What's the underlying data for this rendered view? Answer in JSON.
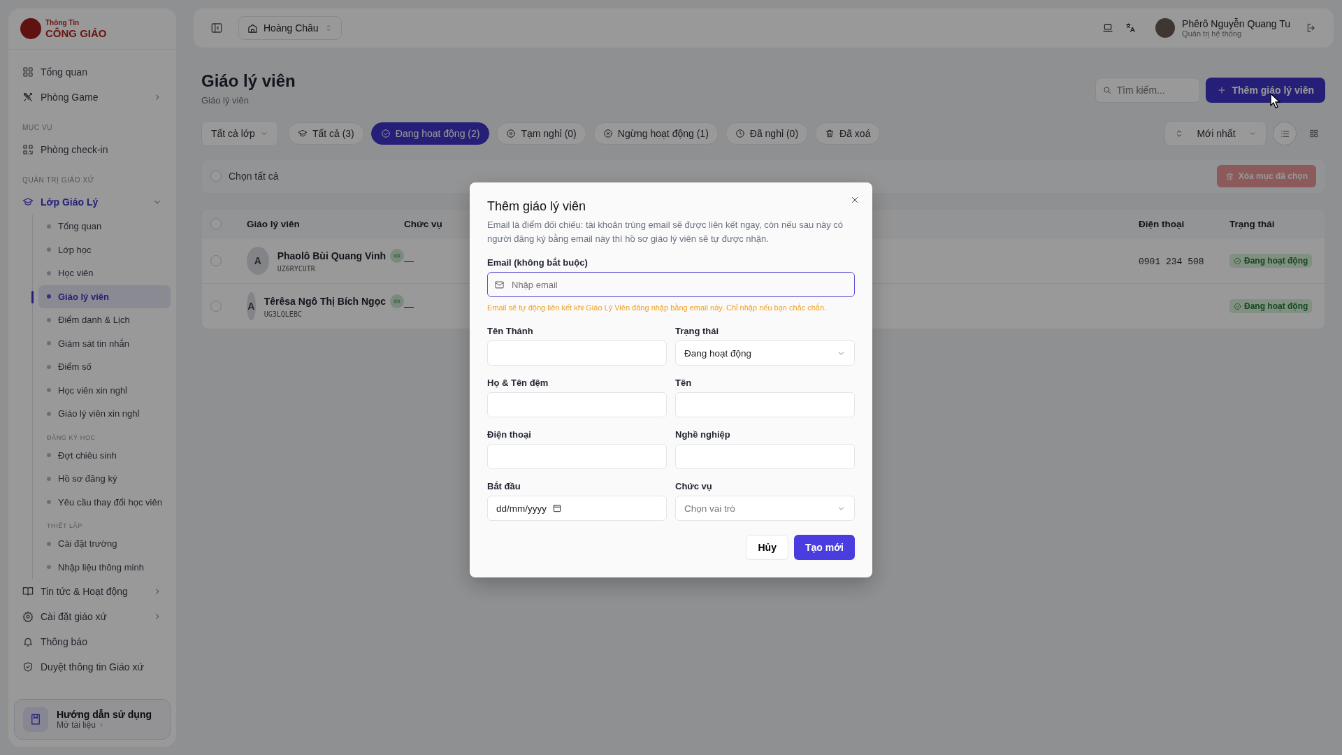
{
  "sidebar": {
    "logo_top": "Thông Tin",
    "logo_bottom": "CÔNG GIÁO",
    "nav": [
      {
        "kind": "link",
        "label": "Tổng quan",
        "expandable": false,
        "selected": false
      },
      {
        "kind": "link",
        "label": "Phòng Game",
        "expandable": true,
        "selected": false
      },
      {
        "kind": "heading",
        "label": "MỤC VỤ"
      },
      {
        "kind": "link",
        "label": "Phòng check-in",
        "expandable": false,
        "selected": false
      },
      {
        "kind": "heading",
        "label": "QUẢN TRỊ GIÁO XỨ"
      },
      {
        "kind": "group",
        "label": "Lớp Giáo Lý",
        "expanded": true,
        "children": [
          {
            "kind": "link",
            "label": "Tổng quan",
            "selected": false
          },
          {
            "kind": "link",
            "label": "Lớp học",
            "selected": false
          },
          {
            "kind": "link",
            "label": "Học viên",
            "selected": false
          },
          {
            "kind": "link",
            "label": "Giáo lý viên",
            "selected": true
          },
          {
            "kind": "link",
            "label": "Điểm danh & Lịch",
            "selected": false
          },
          {
            "kind": "link",
            "label": "Giám sát tin nhắn",
            "selected": false
          },
          {
            "kind": "link",
            "label": "Điểm số",
            "selected": false
          },
          {
            "kind": "link",
            "label": "Học viên xin nghỉ",
            "selected": false
          },
          {
            "kind": "link",
            "label": "Giáo lý viên xin nghỉ",
            "selected": false
          },
          {
            "kind": "heading",
            "label": "ĐĂNG KÝ HỌC"
          },
          {
            "kind": "link",
            "label": "Đợt chiêu sinh",
            "selected": false
          },
          {
            "kind": "link",
            "label": "Hồ sơ đăng ký",
            "selected": false
          },
          {
            "kind": "link",
            "label": "Yêu cầu thay đổi học viên",
            "selected": false
          },
          {
            "kind": "heading",
            "label": "THIẾT LẬP"
          },
          {
            "kind": "link",
            "label": "Cài đặt trường",
            "selected": false
          },
          {
            "kind": "link",
            "label": "Nhập liệu thông minh",
            "selected": false
          }
        ]
      },
      {
        "kind": "link",
        "label": "Tin tức & Hoạt động",
        "expandable": true,
        "selected": false
      },
      {
        "kind": "link",
        "label": "Cài đặt giáo xứ",
        "expandable": true,
        "selected": false
      },
      {
        "kind": "link",
        "label": "Thông báo",
        "expandable": false,
        "selected": false
      },
      {
        "kind": "link",
        "label": "Duyệt thông tin Giáo xứ",
        "expandable": false,
        "selected": false
      }
    ],
    "guide": {
      "title": "Hướng dẫn sử dụng",
      "link": "Mở tài liệu"
    }
  },
  "topbar": {
    "branch": "Hoàng Châu",
    "user_name": "Phêrô Nguyễn Quang Tu",
    "user_role": "Quản trị hệ thống"
  },
  "page": {
    "title": "Giáo lý viên",
    "breadcrumb": "Giáo lý viên",
    "search_placeholder": "Tìm kiếm...",
    "add_button": "Thêm giáo lý viên"
  },
  "filters": {
    "class_select": "Tất cả lớp",
    "tabs": [
      {
        "label": "Tất cả (3)",
        "selected": false
      },
      {
        "label": "Đang hoạt động (2)",
        "selected": true
      },
      {
        "label": "Tạm nghỉ (0)",
        "selected": false
      },
      {
        "label": "Ngừng hoạt động (1)",
        "selected": false
      },
      {
        "label": "Đã nghỉ (0)",
        "selected": false
      },
      {
        "label": "Đã xoá",
        "selected": false
      }
    ],
    "sort": "Mới nhất",
    "views": [
      {
        "kind": "list",
        "selected": true
      },
      {
        "kind": "grid",
        "selected": false
      }
    ]
  },
  "bulk": {
    "select_all": "Chọn tất cả",
    "checked": false,
    "delete_button": "Xóa mục đã chọn",
    "disabled": true
  },
  "table": {
    "header_checked": false,
    "columns": [
      "Giáo lý viên",
      "Chức vụ",
      "Điện thoại",
      "Trạng thái"
    ],
    "rows": [
      {
        "checked": false,
        "avatar": "A",
        "name": "Phaolô Bùi Quang Vinh",
        "linked": true,
        "code": "UZ6RYCUTR",
        "role": "—",
        "phone": "0901 234 508",
        "status": "Đang hoạt động"
      },
      {
        "checked": false,
        "avatar": "A",
        "name": "Têrêsa Ngô Thị Bích Ngọc",
        "linked": true,
        "code": "UG3LQLEBC",
        "role": "—",
        "status": "Đang hoạt động"
      }
    ]
  },
  "modal": {
    "title": "Thêm giáo lý viên",
    "description": "Email là điểm đối chiếu: tài khoản trùng email sẽ được liên kết ngay, còn nếu sau này có người đăng ký bằng email này thì hồ sơ giáo lý viên sẽ tự được nhận.",
    "email_label": "Email (không bắt buộc)",
    "email_placeholder": "Nhập email",
    "email_hint": "Email sẽ tự động liên kết khi Giáo Lý Viên đăng nhập bằng email này. Chỉ nhập nếu bạn chắc chắn.",
    "fields": [
      {
        "kind": "text",
        "label": "Tên Thánh"
      },
      {
        "kind": "select",
        "label": "Trạng thái",
        "value": "Đang hoạt động"
      },
      {
        "kind": "text",
        "label": "Họ & Tên đệm"
      },
      {
        "kind": "text",
        "label": "Tên"
      },
      {
        "kind": "text",
        "label": "Điện thoại"
      },
      {
        "kind": "text",
        "label": "Nghề nghiệp"
      },
      {
        "kind": "date",
        "label": "Bắt đầu",
        "placeholder": "dd/mm/yyyy"
      },
      {
        "kind": "select",
        "label": "Chức vụ",
        "placeholder": "Chọn vai trò"
      }
    ],
    "cancel": "Hủy",
    "submit": "Tạo mới"
  }
}
